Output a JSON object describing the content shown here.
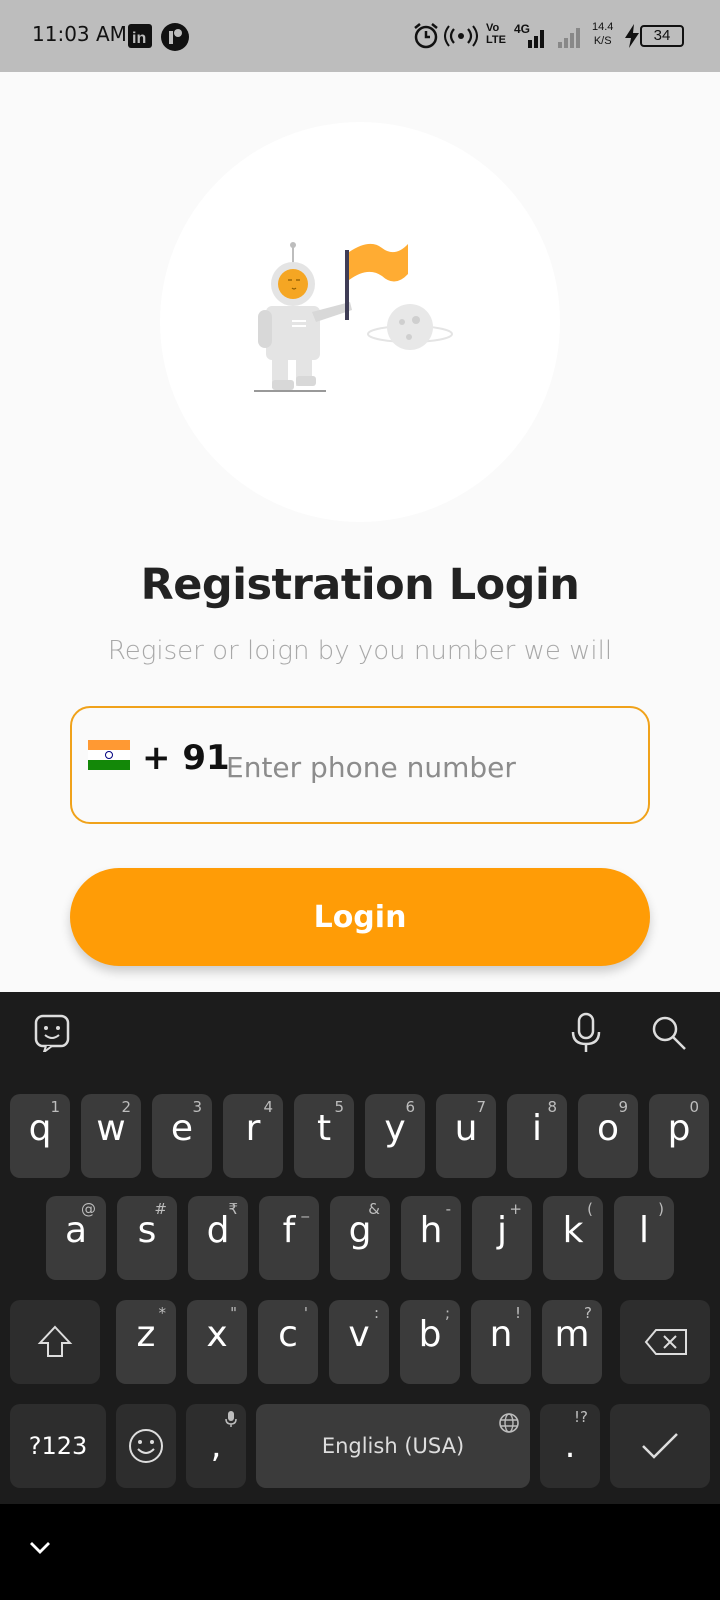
{
  "status_bar": {
    "time": "11:03 AM",
    "apps": [
      "linkedin-icon",
      "app-icon"
    ],
    "icons": [
      "alarm-icon",
      "hotspot-icon",
      "volte-icon",
      "signal-4g-icon",
      "signal-icon",
      "speed-icon",
      "charging-icon",
      "battery-icon"
    ],
    "volte_label": "Vo LTE",
    "net_label": "4G",
    "speed_value": "14.4",
    "speed_unit": "K/S",
    "battery": "34"
  },
  "app": {
    "title": "Registration Login",
    "subtitle": "Regiser or loign by you number we will",
    "country_code": "+ 91",
    "phone_placeholder": "Enter phone number",
    "login_label": "Login"
  },
  "colors": {
    "accent": "#ff9c06",
    "input_border": "#f0a21a",
    "keyboard_bg": "#1c1c1c",
    "key_bg": "#3b3b3b"
  },
  "keyboard": {
    "toolbar": [
      "sticker-icon",
      "mic-icon",
      "search-icon"
    ],
    "row1": [
      {
        "k": "q",
        "h": "1"
      },
      {
        "k": "w",
        "h": "2"
      },
      {
        "k": "e",
        "h": "3"
      },
      {
        "k": "r",
        "h": "4"
      },
      {
        "k": "t",
        "h": "5"
      },
      {
        "k": "y",
        "h": "6"
      },
      {
        "k": "u",
        "h": "7"
      },
      {
        "k": "i",
        "h": "8"
      },
      {
        "k": "o",
        "h": "9"
      },
      {
        "k": "p",
        "h": "0"
      }
    ],
    "row2": [
      {
        "k": "a",
        "h": "@"
      },
      {
        "k": "s",
        "h": "#"
      },
      {
        "k": "d",
        "h": "₹"
      },
      {
        "k": "f",
        "h": "_"
      },
      {
        "k": "g",
        "h": "&"
      },
      {
        "k": "h",
        "h": "-"
      },
      {
        "k": "j",
        "h": "+"
      },
      {
        "k": "k",
        "h": "("
      },
      {
        "k": "l",
        "h": ")"
      }
    ],
    "row3": [
      {
        "k": "z",
        "h": "*"
      },
      {
        "k": "x",
        "h": "\""
      },
      {
        "k": "c",
        "h": "'"
      },
      {
        "k": "v",
        "h": ":"
      },
      {
        "k": "b",
        "h": ";"
      },
      {
        "k": "n",
        "h": "!"
      },
      {
        "k": "m",
        "h": "?"
      }
    ],
    "symbols_label": "?123",
    "comma": ",",
    "space_label": "English (USA)",
    "period": ".",
    "period_hint": "!?"
  }
}
